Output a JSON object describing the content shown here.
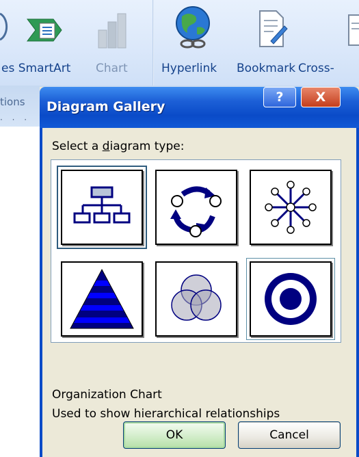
{
  "ribbon": {
    "items": [
      {
        "label": "es SmartArt",
        "icon": "smartart-icon",
        "enabled": true
      },
      {
        "label": "Chart",
        "icon": "chart-icon",
        "enabled": false
      },
      {
        "label": "Hyperlink",
        "icon": "hyperlink-globe-icon",
        "enabled": true
      },
      {
        "label": "Bookmark",
        "icon": "bookmark-icon",
        "enabled": true
      },
      {
        "label": "Cross-",
        "icon": "cross-reference-icon",
        "enabled": true
      }
    ],
    "group_label": "tions",
    "ruler_text": "· · ·"
  },
  "dialog": {
    "title": "Diagram Gallery",
    "help_label": "?",
    "close_label": "X",
    "prompt_pre": "Select a ",
    "prompt_accel": "d",
    "prompt_post": "iagram type:",
    "diagram_types": [
      {
        "icon": "organization-chart-icon",
        "selected": true
      },
      {
        "icon": "cycle-diagram-icon",
        "selected": false
      },
      {
        "icon": "radial-diagram-icon",
        "selected": false
      },
      {
        "icon": "pyramid-diagram-icon",
        "selected": false
      },
      {
        "icon": "venn-diagram-icon",
        "selected": false
      },
      {
        "icon": "target-diagram-icon",
        "selected": false
      }
    ],
    "selected_name": "Organization Chart",
    "selected_description": "Used to show hierarchical relationships",
    "ok_label": "OK",
    "cancel_label": "Cancel"
  },
  "colors": {
    "titlebar": "#0a4bc8",
    "diagram_navy": "#000080",
    "dialog_face": "#ece9d8",
    "ribbon_text": "#15428b"
  }
}
